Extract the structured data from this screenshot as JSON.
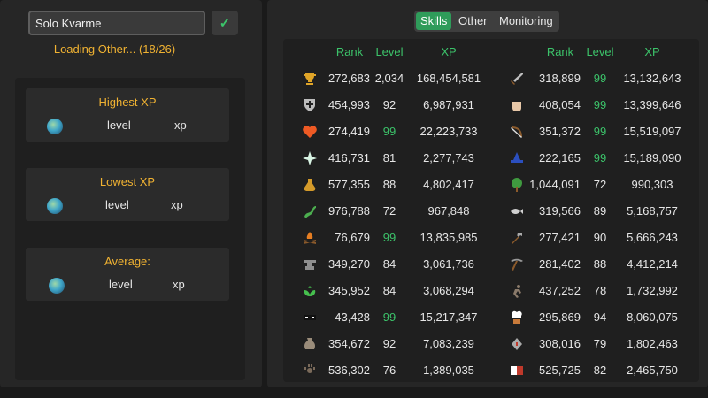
{
  "player_name": "Solo Kvarme",
  "confirm_icon": "✓",
  "loading_text": "Loading Other... (18/26)",
  "cards": [
    {
      "title": "Highest XP",
      "level": "level",
      "xp": "xp"
    },
    {
      "title": "Lowest XP",
      "level": "level",
      "xp": "xp"
    },
    {
      "title": "Average:",
      "level": "level",
      "xp": "xp"
    }
  ],
  "tabs": [
    "Skills",
    "Other",
    "Monitoring"
  ],
  "active_tab": "Skills",
  "headers": {
    "rank": "Rank",
    "level": "Level",
    "xp": "XP"
  },
  "colors": {
    "accent_green": "#3cc36a",
    "gold": "#f0b232",
    "tab_active": "#2f9c5a"
  },
  "left_skills": [
    {
      "icon": "trophy-icon",
      "rank": "272,683",
      "level": "2,034",
      "xp": "168,454,581"
    },
    {
      "icon": "shield-icon",
      "rank": "454,993",
      "level": "92",
      "xp": "6,987,931"
    },
    {
      "icon": "heart-icon",
      "rank": "274,419",
      "level": "99",
      "xp": "22,223,733"
    },
    {
      "icon": "sparkle-icon",
      "rank": "416,731",
      "level": "81",
      "xp": "2,277,743"
    },
    {
      "icon": "potion-icon",
      "rank": "577,355",
      "level": "88",
      "xp": "4,802,417"
    },
    {
      "icon": "snake-icon",
      "rank": "976,788",
      "level": "72",
      "xp": "967,848"
    },
    {
      "icon": "campfire-icon",
      "rank": "76,679",
      "level": "99",
      "xp": "13,835,985"
    },
    {
      "icon": "anvil-icon",
      "rank": "349,270",
      "level": "84",
      "xp": "3,061,736"
    },
    {
      "icon": "herb-icon",
      "rank": "345,952",
      "level": "84",
      "xp": "3,068,294"
    },
    {
      "icon": "mask-icon",
      "rank": "43,428",
      "level": "99",
      "xp": "15,217,347"
    },
    {
      "icon": "pouch-icon",
      "rank": "354,672",
      "level": "92",
      "xp": "7,083,239"
    },
    {
      "icon": "paw-icon",
      "rank": "536,302",
      "level": "76",
      "xp": "1,389,035"
    }
  ],
  "right_skills": [
    {
      "icon": "sword-icon",
      "rank": "318,899",
      "level": "99",
      "xp": "13,132,643"
    },
    {
      "icon": "fist-icon",
      "rank": "408,054",
      "level": "99",
      "xp": "13,399,646"
    },
    {
      "icon": "bow-icon",
      "rank": "351,372",
      "level": "99",
      "xp": "15,519,097"
    },
    {
      "icon": "wizard-hat-icon",
      "rank": "222,165",
      "level": "99",
      "xp": "15,189,090"
    },
    {
      "icon": "tree-icon",
      "rank": "1,044,091",
      "level": "72",
      "xp": "990,303"
    },
    {
      "icon": "fish-icon",
      "rank": "319,566",
      "level": "89",
      "xp": "5,168,757"
    },
    {
      "icon": "hammer-icon",
      "rank": "277,421",
      "level": "90",
      "xp": "5,666,243"
    },
    {
      "icon": "pickaxe-icon",
      "rank": "281,402",
      "level": "88",
      "xp": "4,412,214"
    },
    {
      "icon": "runner-icon",
      "rank": "437,252",
      "level": "78",
      "xp": "1,732,992"
    },
    {
      "icon": "chef-icon",
      "rank": "295,869",
      "level": "94",
      "xp": "8,060,075"
    },
    {
      "icon": "rune-icon",
      "rank": "308,016",
      "level": "79",
      "xp": "1,802,463"
    },
    {
      "icon": "flag-icon",
      "rank": "525,725",
      "level": "82",
      "xp": "2,465,750"
    }
  ]
}
